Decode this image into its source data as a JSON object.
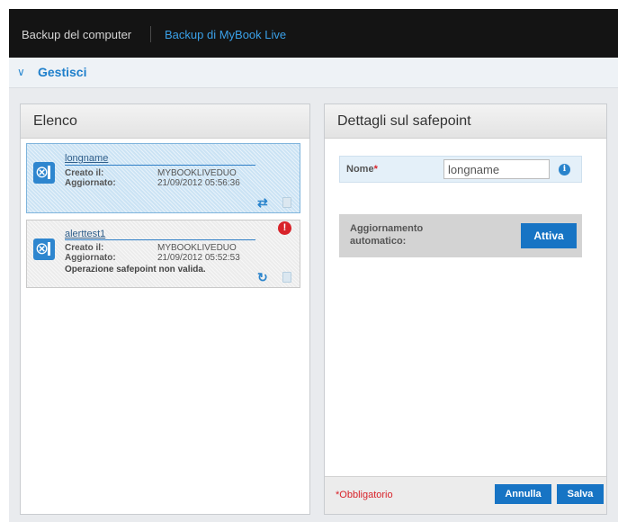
{
  "header": {
    "tab_computer": "Backup del computer",
    "tab_mybook": "Backup di MyBook Live"
  },
  "gestisci": {
    "label": "Gestisci"
  },
  "list_panel": {
    "title": "Elenco",
    "items": [
      {
        "name": "longname",
        "created_label": "Creato il:",
        "created_value": "MYBOOKLIVEDUO",
        "updated_label": "Aggiornato:",
        "updated_value": "21/09/2012 05:56:36",
        "selected": true
      },
      {
        "name": "alerttest1",
        "created_label": "Creato il:",
        "created_value": "MYBOOKLIVEDUO",
        "updated_label": "Aggiornato:",
        "updated_value": "21/09/2012 05:52:53",
        "error": "Operazione safepoint non valida.",
        "alert": "!"
      }
    ]
  },
  "details_panel": {
    "title": "Dettagli sul safepoint",
    "name_label": "Nome",
    "required_mark": "*",
    "name_value": "longname",
    "auto_update_label": "Aggiornamento automatico:",
    "enable_button": "Attiva",
    "required_note": "*Obbligatorio",
    "cancel_button": "Annulla",
    "save_button": "Salva"
  },
  "colors": {
    "accent": "#1774c4",
    "topbar": "#141414",
    "selected_item": "#cbe3f4",
    "alert": "#d8232a"
  }
}
